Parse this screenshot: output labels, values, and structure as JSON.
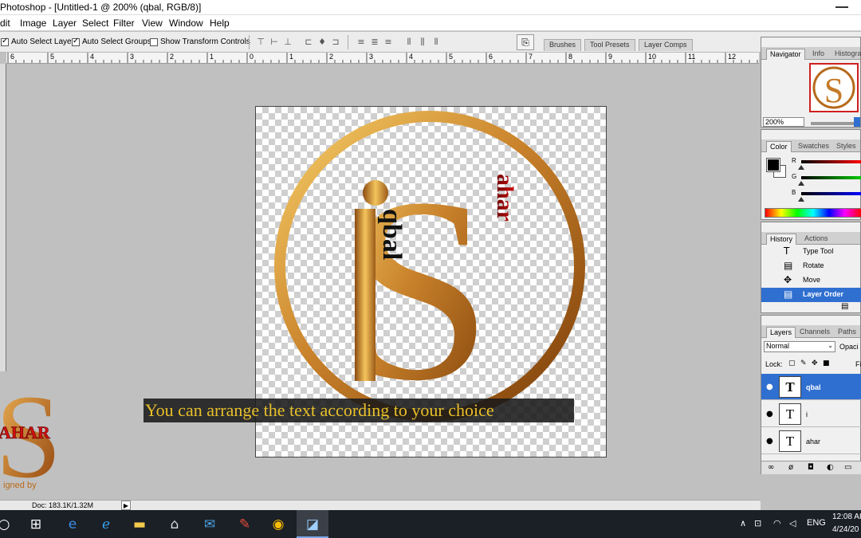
{
  "titlebar": {
    "title": "Photoshop - [Untitled-1 @ 200% (qbal, RGB/8)]"
  },
  "menu": [
    "dit",
    "Image",
    "Layer",
    "Select",
    "Filter",
    "View",
    "Window",
    "Help"
  ],
  "options": {
    "auto_select_layer": {
      "label": "Auto Select Layer",
      "checked": true
    },
    "auto_select_groups": {
      "label": "Auto Select Groups",
      "checked": true
    },
    "show_transform_controls": {
      "label": "Show Transform Controls",
      "checked": false
    }
  },
  "palette_well": {
    "tabs": [
      "Brushes",
      "Tool Presets",
      "Layer Comps"
    ]
  },
  "ruler": {
    "labels": [
      "6",
      "5",
      "4",
      "3",
      "2",
      "1",
      "0",
      "1",
      "2",
      "3",
      "4",
      "5",
      "6",
      "7",
      "8",
      "9",
      "10",
      "11",
      "12"
    ]
  },
  "artwork": {
    "monogram_letter": "S",
    "i_letter": "i",
    "text_qbal": "qbal",
    "text_ahar": "ahar"
  },
  "caption": {
    "text": "You can arrange the text according to your choice"
  },
  "watermark": {
    "letter": "S",
    "name": "AHAR",
    "tag": "igned by"
  },
  "statusbar": {
    "doc": "Doc: 183.1K/1.32M",
    "arrow": "▶"
  },
  "navigator": {
    "tabs": [
      "Navigator",
      "Info",
      "Histogra"
    ],
    "zoom": "200%"
  },
  "color_panel": {
    "tabs": [
      "Color",
      "Swatches",
      "Styles"
    ],
    "channels": [
      "R",
      "G",
      "B"
    ]
  },
  "history": {
    "tabs": [
      "History",
      "Actions"
    ],
    "items": [
      {
        "label": "Type Tool",
        "icon": "T",
        "selected": false
      },
      {
        "label": "Rotate",
        "icon": "▤",
        "selected": false
      },
      {
        "label": "Move",
        "icon": "✥",
        "selected": false
      },
      {
        "label": "Layer Order",
        "icon": "▤",
        "selected": true
      }
    ]
  },
  "layers": {
    "tabs": [
      "Layers",
      "Channels",
      "Paths"
    ],
    "blend_mode": "Normal",
    "opacity_label": "Opaci",
    "lock_label": "Lock:",
    "fill_label": "Fi",
    "items": [
      {
        "name": "qbal",
        "thumb": "T",
        "selected": true
      },
      {
        "name": "i",
        "thumb": "T",
        "selected": false
      },
      {
        "name": "ahar",
        "thumb": "T",
        "selected": false
      }
    ]
  },
  "taskbar": {
    "lang": "ENG",
    "time": "12:08 AI",
    "date": "4/24/20"
  },
  "colors": {
    "accent": "#2f6fd0",
    "gold_light": "#f7cf68",
    "gold_dark": "#7a3c08",
    "caption_text": "#e8c02a"
  }
}
